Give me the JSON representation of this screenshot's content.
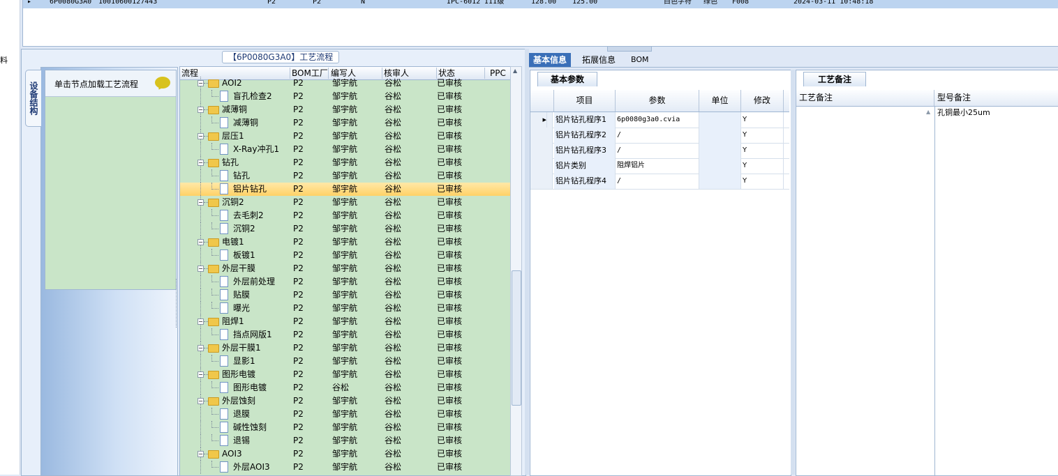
{
  "left_strip_char": "料",
  "top_grid": {
    "row": [
      "6P0080G3A0",
      "10010600127443",
      "P2",
      "P2",
      "N",
      "IPC-6012 III级",
      "128.00",
      "125.00",
      "白色字符",
      "绿色",
      "F008",
      "2024-03-11 10:48:18"
    ]
  },
  "left_tab": {
    "vertical_label": "设备结构"
  },
  "hint": {
    "text": "单击节点加载工艺流程"
  },
  "process": {
    "title": "【6P0080G3A0】工艺流程",
    "headers": [
      "流程",
      "BOM工厂",
      "编写人",
      "核审人",
      "状态",
      "PPC"
    ],
    "rows": [
      {
        "type": "folder",
        "name": "AOI2",
        "factory": "P2",
        "writer": "邹宇航",
        "reviewer": "谷松",
        "status": "已审核"
      },
      {
        "type": "file",
        "name": "盲孔检查2",
        "factory": "P2",
        "writer": "邹宇航",
        "reviewer": "谷松",
        "status": "已审核"
      },
      {
        "type": "folder",
        "name": "减薄铜",
        "factory": "P2",
        "writer": "邹宇航",
        "reviewer": "谷松",
        "status": "已审核"
      },
      {
        "type": "file",
        "name": "减薄铜",
        "factory": "P2",
        "writer": "邹宇航",
        "reviewer": "谷松",
        "status": "已审核"
      },
      {
        "type": "folder",
        "name": "层压1",
        "factory": "P2",
        "writer": "邹宇航",
        "reviewer": "谷松",
        "status": "已审核"
      },
      {
        "type": "file",
        "name": "X-Ray冲孔1",
        "factory": "P2",
        "writer": "邹宇航",
        "reviewer": "谷松",
        "status": "已审核"
      },
      {
        "type": "folder",
        "name": "钻孔",
        "factory": "P2",
        "writer": "邹宇航",
        "reviewer": "谷松",
        "status": "已审核"
      },
      {
        "type": "file",
        "name": "钻孔",
        "factory": "P2",
        "writer": "邹宇航",
        "reviewer": "谷松",
        "status": "已审核"
      },
      {
        "type": "file",
        "name": "铝片钻孔",
        "factory": "P2",
        "writer": "邹宇航",
        "reviewer": "谷松",
        "status": "已审核",
        "selected": true
      },
      {
        "type": "folder",
        "name": "沉铜2",
        "factory": "P2",
        "writer": "邹宇航",
        "reviewer": "谷松",
        "status": "已审核"
      },
      {
        "type": "file",
        "name": "去毛刺2",
        "factory": "P2",
        "writer": "邹宇航",
        "reviewer": "谷松",
        "status": "已审核"
      },
      {
        "type": "file",
        "name": "沉铜2",
        "factory": "P2",
        "writer": "邹宇航",
        "reviewer": "谷松",
        "status": "已审核"
      },
      {
        "type": "folder",
        "name": "电镀1",
        "factory": "P2",
        "writer": "邹宇航",
        "reviewer": "谷松",
        "status": "已审核"
      },
      {
        "type": "file",
        "name": "板镀1",
        "factory": "P2",
        "writer": "邹宇航",
        "reviewer": "谷松",
        "status": "已审核"
      },
      {
        "type": "folder",
        "name": "外层干膜",
        "factory": "P2",
        "writer": "邹宇航",
        "reviewer": "谷松",
        "status": "已审核"
      },
      {
        "type": "file",
        "name": "外层前处理",
        "factory": "P2",
        "writer": "邹宇航",
        "reviewer": "谷松",
        "status": "已审核"
      },
      {
        "type": "file",
        "name": "贴膜",
        "factory": "P2",
        "writer": "邹宇航",
        "reviewer": "谷松",
        "status": "已审核"
      },
      {
        "type": "file",
        "name": "曝光",
        "factory": "P2",
        "writer": "邹宇航",
        "reviewer": "谷松",
        "status": "已审核"
      },
      {
        "type": "folder",
        "name": "阻焊1",
        "factory": "P2",
        "writer": "邹宇航",
        "reviewer": "谷松",
        "status": "已审核"
      },
      {
        "type": "file",
        "name": "挡点网版1",
        "factory": "P2",
        "writer": "邹宇航",
        "reviewer": "谷松",
        "status": "已审核"
      },
      {
        "type": "folder",
        "name": "外层干膜1",
        "factory": "P2",
        "writer": "邹宇航",
        "reviewer": "谷松",
        "status": "已审核"
      },
      {
        "type": "file",
        "name": "显影1",
        "factory": "P2",
        "writer": "邹宇航",
        "reviewer": "谷松",
        "status": "已审核"
      },
      {
        "type": "folder",
        "name": "图形电镀",
        "factory": "P2",
        "writer": "邹宇航",
        "reviewer": "谷松",
        "status": "已审核"
      },
      {
        "type": "file",
        "name": "图形电镀",
        "factory": "P2",
        "writer": "谷松",
        "reviewer": "谷松",
        "status": "已审核"
      },
      {
        "type": "folder",
        "name": "外层蚀刻",
        "factory": "P2",
        "writer": "邹宇航",
        "reviewer": "谷松",
        "status": "已审核"
      },
      {
        "type": "file",
        "name": "退膜",
        "factory": "P2",
        "writer": "邹宇航",
        "reviewer": "谷松",
        "status": "已审核"
      },
      {
        "type": "file",
        "name": "碱性蚀刻",
        "factory": "P2",
        "writer": "邹宇航",
        "reviewer": "谷松",
        "status": "已审核"
      },
      {
        "type": "file",
        "name": "退锡",
        "factory": "P2",
        "writer": "邹宇航",
        "reviewer": "谷松",
        "status": "已审核"
      },
      {
        "type": "folder",
        "name": "AOI3",
        "factory": "P2",
        "writer": "邹宇航",
        "reviewer": "谷松",
        "status": "已审核"
      },
      {
        "type": "file",
        "name": "外层AOI3",
        "factory": "P2",
        "writer": "邹宇航",
        "reviewer": "谷松",
        "status": "已审核"
      }
    ]
  },
  "tabs": [
    "基本信息",
    "拓展信息",
    "BOM"
  ],
  "basic": {
    "subtab": "基本参数",
    "headers": [
      "项目",
      "参数",
      "单位",
      "修改"
    ],
    "rows": [
      {
        "item": "铝片钻孔程序1",
        "param": "6p0080g3a0.cvia",
        "unit": "",
        "modify": "Y",
        "current": true
      },
      {
        "item": "铝片钻孔程序2",
        "param": "/",
        "unit": "",
        "modify": "Y"
      },
      {
        "item": "铝片钻孔程序3",
        "param": "/",
        "unit": "",
        "modify": "Y"
      },
      {
        "item": "铝片类别",
        "param": "阻焊铝片",
        "unit": "",
        "modify": "Y"
      },
      {
        "item": "铝片钻孔程序4",
        "param": "/",
        "unit": "",
        "modify": "Y"
      }
    ]
  },
  "remark": {
    "subtab": "工艺备注",
    "headers": [
      "工艺备注",
      "型号备注"
    ],
    "model_note": "孔铜最小25um"
  },
  "colors": {
    "tree_bg": "#c9e5c8",
    "selected_row": "#ffd166",
    "active_tab": "#3a6fb8"
  }
}
